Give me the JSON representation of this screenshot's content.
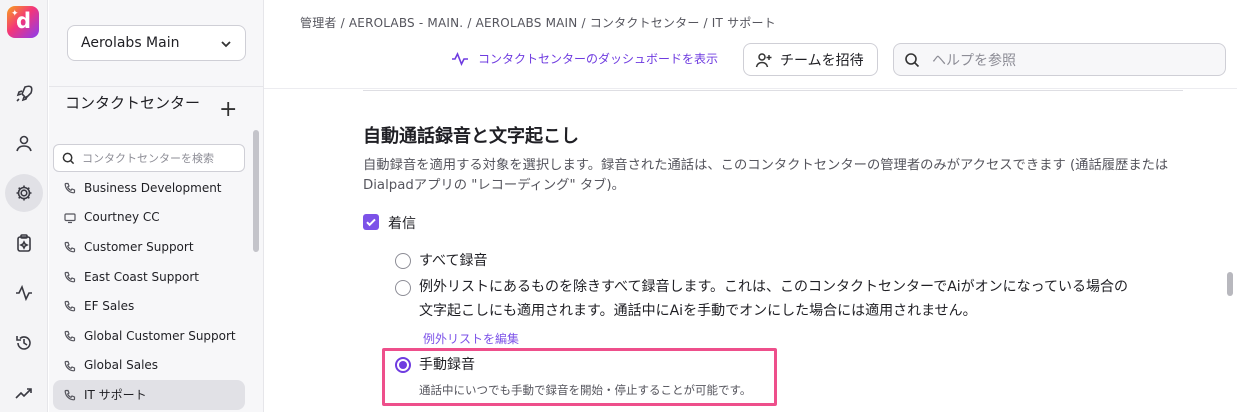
{
  "app": {
    "logo_letter": "d"
  },
  "sidebar": {
    "workspace": "Aerolabs Main",
    "title": "コンタクトセンター",
    "search_placeholder": "コンタクトセンターを検索",
    "items": [
      {
        "label": "Business Development",
        "icon": "phone-icon"
      },
      {
        "label": "Courtney CC",
        "icon": "monitor-icon"
      },
      {
        "label": "Customer Support",
        "icon": "phone-icon"
      },
      {
        "label": "East Coast Support",
        "icon": "phone-icon"
      },
      {
        "label": "EF Sales",
        "icon": "phone-icon"
      },
      {
        "label": "Global Customer Support",
        "icon": "phone-icon"
      },
      {
        "label": "Global Sales",
        "icon": "phone-icon"
      },
      {
        "label": "IT サポート",
        "icon": "phone-icon",
        "active": true
      }
    ]
  },
  "header": {
    "breadcrumb": "管理者 / AEROLABS - MAIN. / AEROLABS MAIN / コンタクトセンター / IT サポート",
    "dashboard_link": "コンタクトセンターのダッシュボードを表示",
    "invite_label": "チームを招待",
    "help_placeholder": "ヘルプを参照"
  },
  "content": {
    "section_title": "自動通話録音と文字起こし",
    "section_desc": "自動録音を適用する対象を選択します。録音された通話は、このコンタクトセンターの管理者のみがアクセスできます (通話履歴またはDialpadアプリの \"レコーディング\" タブ)。",
    "incoming_label": "着信",
    "incoming_checked": true,
    "options": {
      "all": {
        "label": "すべて録音",
        "selected": false
      },
      "except": {
        "label": "例外リストにあるものを除きすべて録音します。これは、このコンタクトセンターでAiがオンになっている場合の",
        "desc": "文字起こしにも適用されます。通話中にAiを手動でオンにした場合には適用されません。",
        "selected": false
      },
      "manual": {
        "label": "手動録音",
        "desc": "通話中にいつでも手動で録音を開始・停止することが可能です。",
        "selected": true
      }
    },
    "exception_link": "例外リストを編集"
  },
  "colors": {
    "accent": "#6f3ce0",
    "highlight": "#ee4f8b"
  }
}
